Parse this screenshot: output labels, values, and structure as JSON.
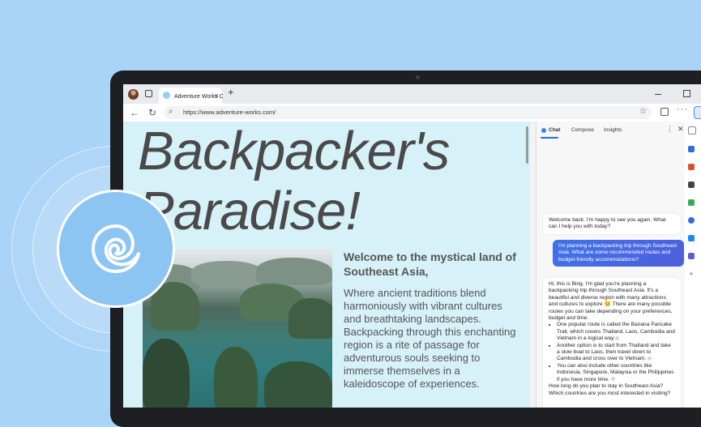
{
  "browser": {
    "tab_title": "Adventure Works C",
    "tab_close": "×",
    "new_tab": "+",
    "url": "https://www.adventure-works.com/"
  },
  "page": {
    "headline_line1": "Backpacker's",
    "headline_line2": "Paradise!",
    "intro_heading": "Welcome to the mystical land of Southeast Asia,",
    "intro_body": "Where ancient traditions blend harmoniously with vibrant cultures and breathtaking landscapes. Backpacking through this enchanting region is a rite of passage for adventurous souls seeking to immerse themselves in a kaleidoscope of experiences."
  },
  "sidebar": {
    "tabs": [
      "Chat",
      "Compose",
      "Insights"
    ],
    "messages": {
      "welcome": "Welcome back. I'm happy to see you again. What can I help you with today?",
      "user": "I'm planning a backpacking trip through Southeast Asia. What are some recommended routes and budget-friendly accommodations?",
      "answer_intro": "Hi, this is Bing. I'm glad you're planning a backpacking trip through Southeast Asia. It's a beautiful and diverse region with many attractions and cultures to explore 😊 There are many possible routes you can take depending on your preferences, budget and time.",
      "bullets": [
        "One popular route is called the Banana Pancake Trail, which covers Thailand, Laos, Cambodia and Vietnam in a logical way",
        "Another option is to start from Thailand and take a slow boat to Laos, then travel down to Cambodia and cross over to Vietnam.",
        "You can also include other countries like Indonesia, Singapore, Malaysia or the Philippines if you have more time."
      ],
      "answer_outro": "How long do you plan to stay in Southeast Asia? Which countries are you most interested in visiting?"
    }
  },
  "colors": {
    "background": "#a9d3f7",
    "accent": "#3f73e6",
    "page_bg": "#d7f1f8"
  }
}
